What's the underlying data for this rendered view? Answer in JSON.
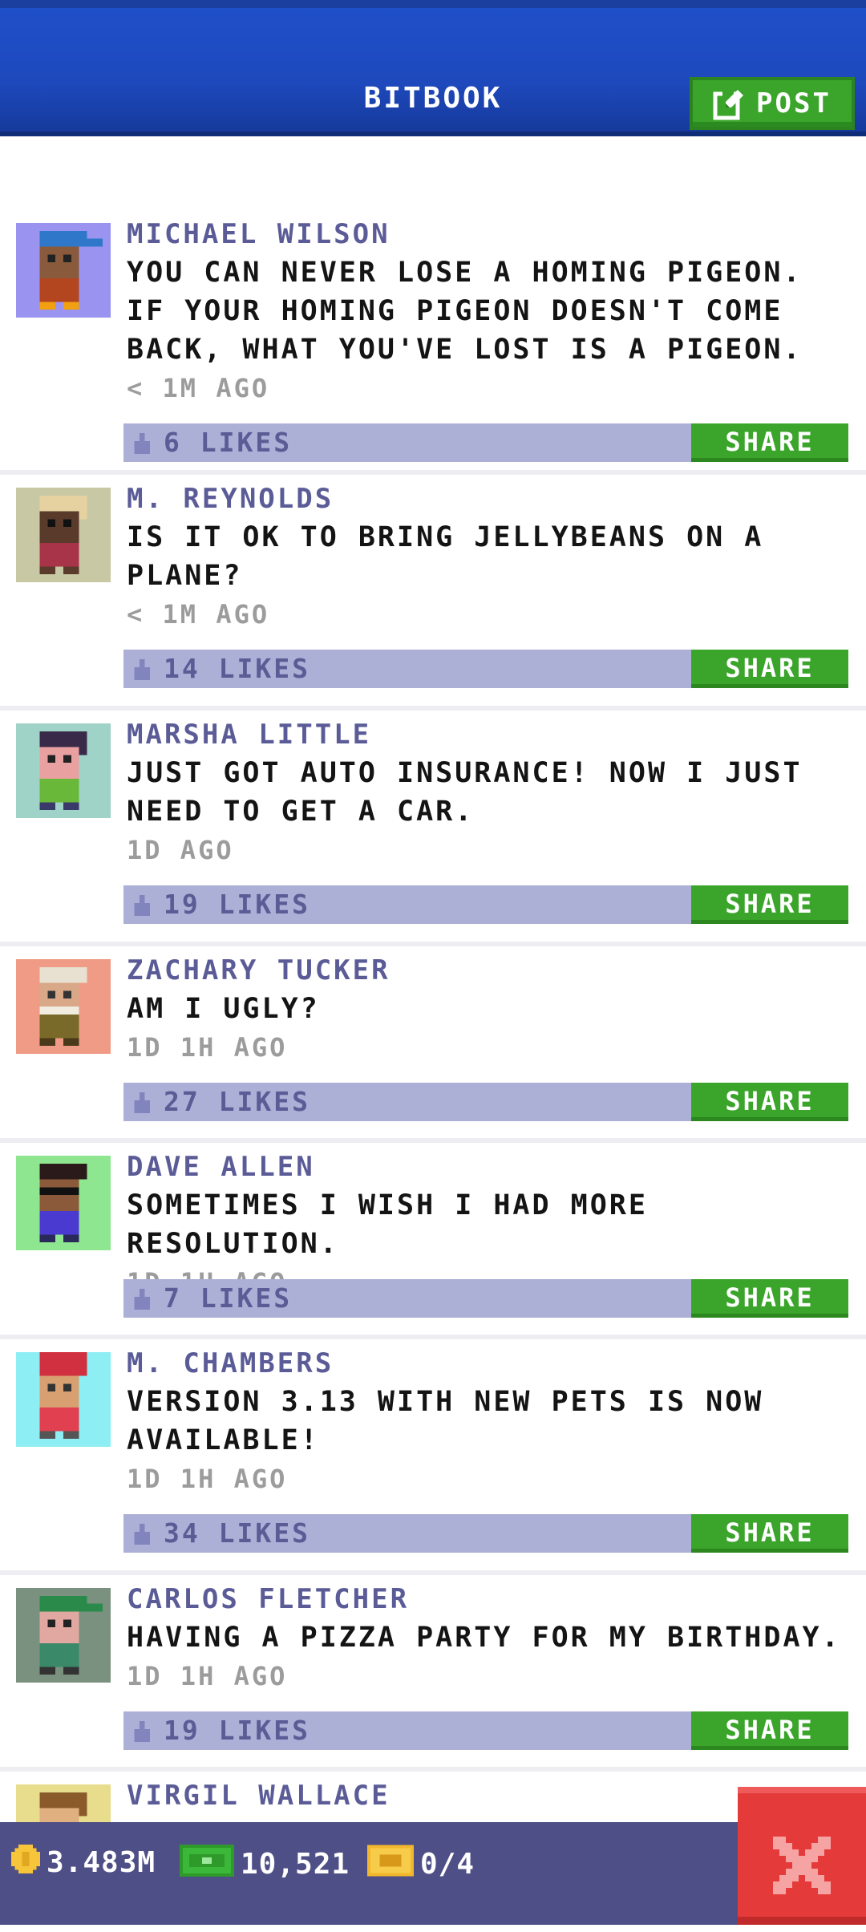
{
  "header": {
    "title": "BITBOOK",
    "post_label": "POST"
  },
  "posts": [
    {
      "name": "MICHAEL WILSON",
      "text": "YOU CAN NEVER LOSE A HOMING PIGEON. IF YOUR HOMING PIGEON DOESN'T COME BACK, WHAT YOU'VE LOST IS A PIGEON.",
      "time": "< 1M AGO",
      "likes": "6 LIKES",
      "share": "SHARE",
      "avatar_bg": "#9a94f0"
    },
    {
      "name": "M. REYNOLDS",
      "text": "IS IT OK TO BRING JELLYBEANS ON A PLANE?",
      "time": "< 1M AGO",
      "likes": "14 LIKES",
      "share": "SHARE",
      "avatar_bg": "#c9c8a4"
    },
    {
      "name": "MARSHA LITTLE",
      "text": "JUST GOT AUTO INSURANCE! NOW I JUST NEED TO GET A CAR.",
      "time": "1D AGO",
      "likes": "19 LIKES",
      "share": "SHARE",
      "avatar_bg": "#9fd3c8"
    },
    {
      "name": "ZACHARY TUCKER",
      "text": "AM I UGLY?",
      "time": "1D 1H AGO",
      "likes": "27 LIKES",
      "share": "SHARE",
      "avatar_bg": "#ef9b86"
    },
    {
      "name": "DAVE ALLEN",
      "text": "SOMETIMES I WISH I HAD MORE RESOLUTION.",
      "time": "1D 1H AGO",
      "likes": "7 LIKES",
      "share": "SHARE",
      "avatar_bg": "#8fe690"
    },
    {
      "name": "M. CHAMBERS",
      "text": "VERSION 3.13 WITH NEW PETS IS NOW AVAILABLE!",
      "time": "1D 1H AGO",
      "likes": "34 LIKES",
      "share": "SHARE",
      "avatar_bg": "#8deef4"
    },
    {
      "name": "CARLOS FLETCHER",
      "text": "HAVING A PIZZA PARTY FOR MY BIRTHDAY.",
      "time": "1D 1H AGO",
      "likes": "19 LIKES",
      "share": "SHARE",
      "avatar_bg": "#7a917f"
    },
    {
      "name": "VIRGIL WALLACE",
      "avatar_bg": "#e8dd8c"
    }
  ],
  "status_bar": {
    "coins": "3.483M",
    "bux": "10,521",
    "tickets": "0/4"
  },
  "colors": {
    "header_blue": "#1f4fc9",
    "share_green": "#3aa52a",
    "like_bar": "#acafd6",
    "name_purple": "#5b5c97",
    "close_red": "#e43a3a"
  }
}
